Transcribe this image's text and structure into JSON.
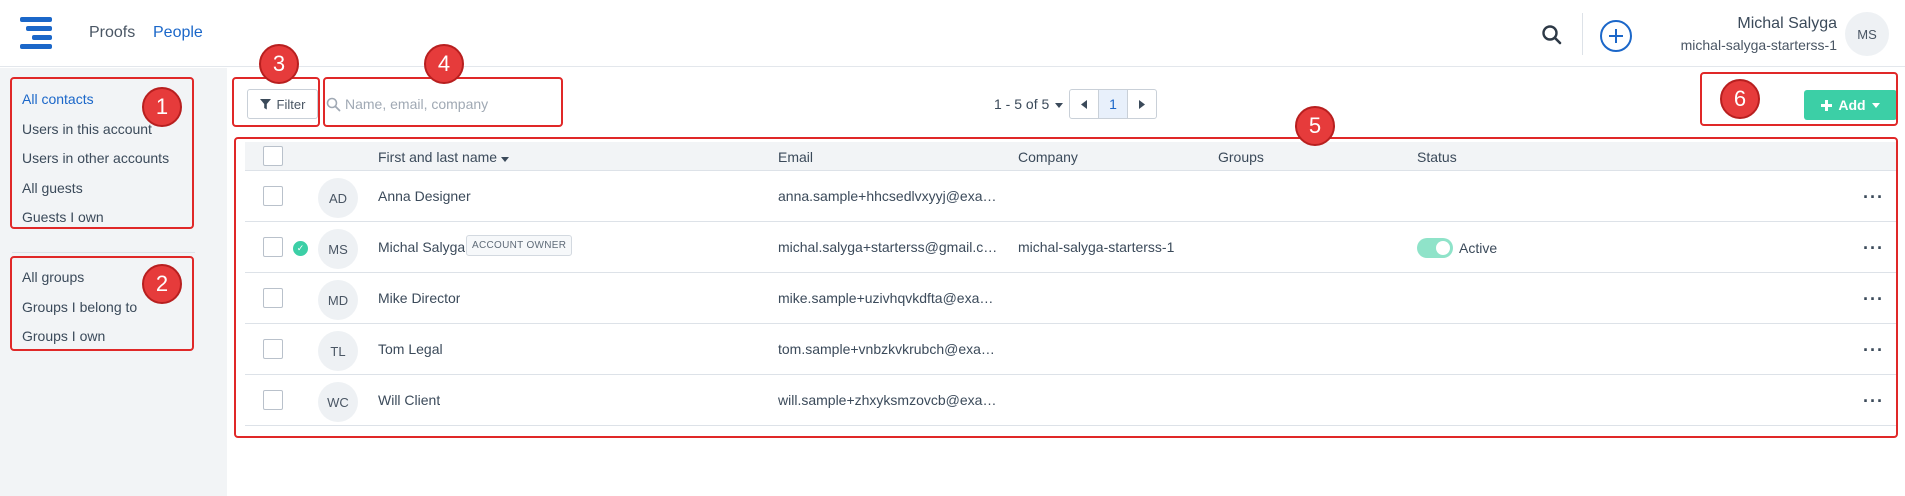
{
  "header": {
    "nav": [
      "Proofs",
      "People"
    ],
    "active_nav": "People",
    "user_name": "Michal Salyga",
    "user_account": "michal-salyga-starterss-1",
    "avatar_initials": "MS"
  },
  "sidebar": {
    "contacts": [
      "All contacts",
      "Users in this account",
      "Users in other accounts",
      "All guests",
      "Guests I own"
    ],
    "groups": [
      "All groups",
      "Groups I belong to",
      "Groups I own"
    ]
  },
  "toolbar": {
    "filter_label": "Filter",
    "search_placeholder": "Name, email, company",
    "pager_label": "1 - 5 of 5",
    "current_page": "1",
    "add_label": "Add"
  },
  "table": {
    "columns": {
      "name": "First and last name",
      "email": "Email",
      "company": "Company",
      "groups": "Groups",
      "status": "Status"
    },
    "rows": [
      {
        "initials": "AD",
        "name": "Anna Designer",
        "badge": "",
        "email": "anna.sample+hhcsedlvxyyj@exam...",
        "company": "",
        "status": ""
      },
      {
        "initials": "MS",
        "name": "Michal Salyga",
        "badge": "ACCOUNT OWNER",
        "email": "michal.salyga+starterss@gmail.com",
        "company": "michal-salyga-starterss-1",
        "status": "Active"
      },
      {
        "initials": "MD",
        "name": "Mike Director",
        "badge": "",
        "email": "mike.sample+uzivhqvkdfta@exam...",
        "company": "",
        "status": ""
      },
      {
        "initials": "TL",
        "name": "Tom Legal",
        "badge": "",
        "email": "tom.sample+vnbzkvkrubch@exam...",
        "company": "",
        "status": ""
      },
      {
        "initials": "WC",
        "name": "Will Client",
        "badge": "",
        "email": "will.sample+zhxyksmzovcb@exam...",
        "company": "",
        "status": ""
      }
    ]
  },
  "annotations": [
    "1",
    "2",
    "3",
    "4",
    "5",
    "6"
  ],
  "colors": {
    "brand_blue": "#1b67c9",
    "accent_green": "#3ccfa6",
    "annotation_red": "#e02828"
  }
}
